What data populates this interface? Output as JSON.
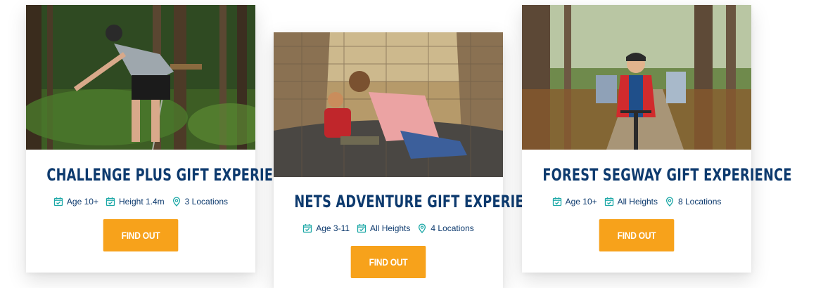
{
  "colors": {
    "title": "#0d3a6e",
    "icon_teal": "#1aa7a6",
    "cta_orange": "#f7a21b"
  },
  "cards": [
    {
      "title": "CHALLENGE PLUS GIFT EXPERIENCE",
      "meta": [
        {
          "icon": "calendar-check-icon",
          "text": "Age 10+"
        },
        {
          "icon": "calendar-check-icon",
          "text": "Height 1.4m"
        },
        {
          "icon": "location-pin-icon",
          "text": "3 Locations"
        }
      ],
      "cta": "FIND OUT MORE",
      "image": "photo of a person on a treetop rope course in a forest"
    },
    {
      "title": "NETS ADVENTURE GIFT EXPERIENCE",
      "meta": [
        {
          "icon": "calendar-check-icon",
          "text": "Age 3-11"
        },
        {
          "icon": "calendar-check-icon",
          "text": "All Heights"
        },
        {
          "icon": "location-pin-icon",
          "text": "4 Locations"
        }
      ],
      "cta": "FIND OUT MORE",
      "image": "photo of an adult and child crawling on a rope net tunnel"
    },
    {
      "title": "FOREST SEGWAY GIFT EXPERIENCE",
      "meta": [
        {
          "icon": "calendar-check-icon",
          "text": "Age 10+"
        },
        {
          "icon": "calendar-check-icon",
          "text": "All Heights"
        },
        {
          "icon": "location-pin-icon",
          "text": "8 Locations"
        }
      ],
      "cta": "FIND OUT MORE",
      "image": "photo of a child riding a segway on a forest trail"
    }
  ]
}
